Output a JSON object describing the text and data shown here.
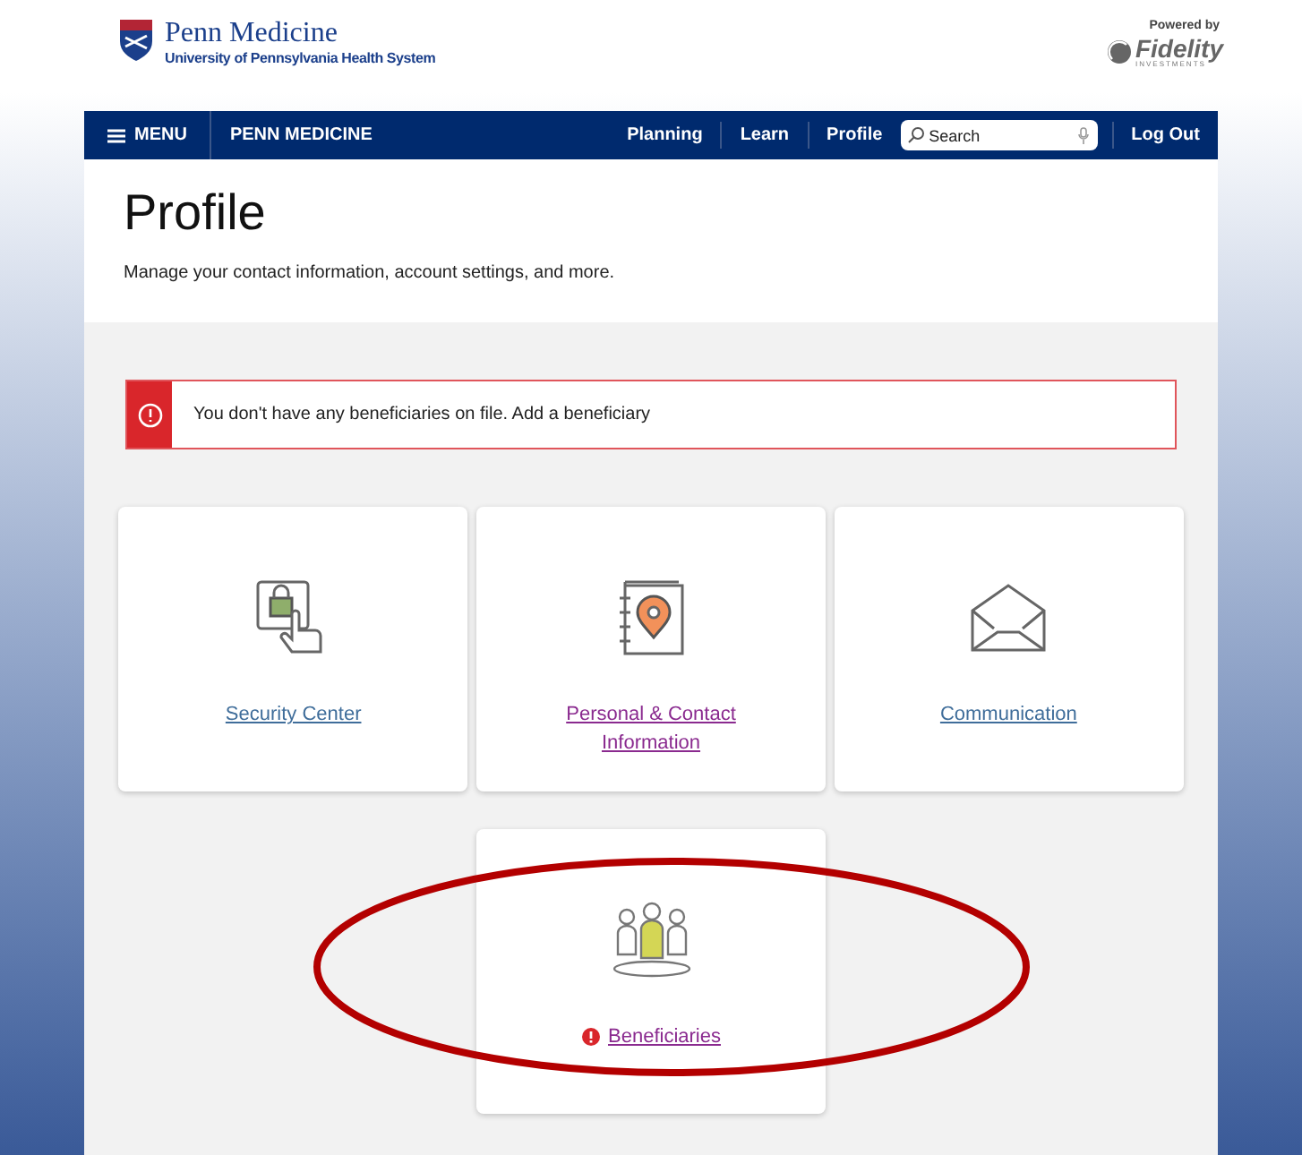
{
  "header": {
    "brand_name": "Penn Medicine",
    "brand_subtitle": "University of Pennsylvania Health System",
    "powered_by": "Powered by",
    "partner_name": "Fidelity",
    "partner_tagline": "INVESTMENTS"
  },
  "nav": {
    "menu": "MENU",
    "home": "PENN MEDICINE",
    "links": [
      "Planning",
      "Learn",
      "Profile"
    ],
    "search": {
      "placeholder": "Search"
    },
    "logout": "Log Out"
  },
  "page": {
    "title": "Profile",
    "subtitle": "Manage your contact information, account settings, and more."
  },
  "alert": {
    "message": "You don't have any beneficiaries on file. Add a beneficiary"
  },
  "cards": [
    {
      "kind": "security",
      "label": "Security Center",
      "visited": false,
      "alert": false,
      "highlighted": false
    },
    {
      "kind": "contact",
      "label": "Personal & Contact Information",
      "visited": true,
      "alert": false,
      "highlighted": false
    },
    {
      "kind": "communication",
      "label": "Communication",
      "visited": false,
      "alert": false,
      "highlighted": false
    },
    {
      "kind": "beneficiaries",
      "label": "Beneficiaries",
      "visited": true,
      "alert": true,
      "highlighted": true
    }
  ]
}
